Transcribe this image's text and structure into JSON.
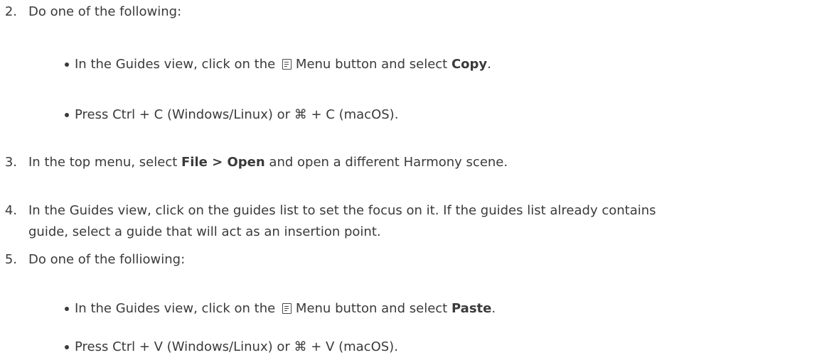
{
  "steps": [
    {
      "number": "2.",
      "text": "Do one of the following:",
      "bullets": [
        {
          "pre": "In the Guides view, click on the",
          "icon": "menu-icon",
          "mid": "Menu button and select",
          "bold": "Copy",
          "post": "."
        },
        {
          "pre": "Press Ctrl + C (Windows/Linux) or",
          "cmd": "⌘",
          "post": "+ C (macOS)."
        }
      ]
    },
    {
      "number": "3.",
      "pre": "In the top menu, select",
      "bold": "File > Open",
      "post": "and open a different Harmony scene."
    },
    {
      "number": "4.",
      "line1": "In the Guides view, click on the guides list to set the focus on it. If the guides list already contains",
      "line2": "guide, select a guide that will act as an insertion point."
    },
    {
      "number": "5.",
      "text": "Do one of the folliowing:",
      "bullets": [
        {
          "pre": "In the Guides view, click on the",
          "icon": "menu-icon",
          "mid": "Menu button and select",
          "bold": "Paste",
          "post": "."
        },
        {
          "pre": "Press Ctrl + V (Windows/Linux) or",
          "cmd": "⌘",
          "post": "+ V (macOS)."
        }
      ]
    }
  ]
}
